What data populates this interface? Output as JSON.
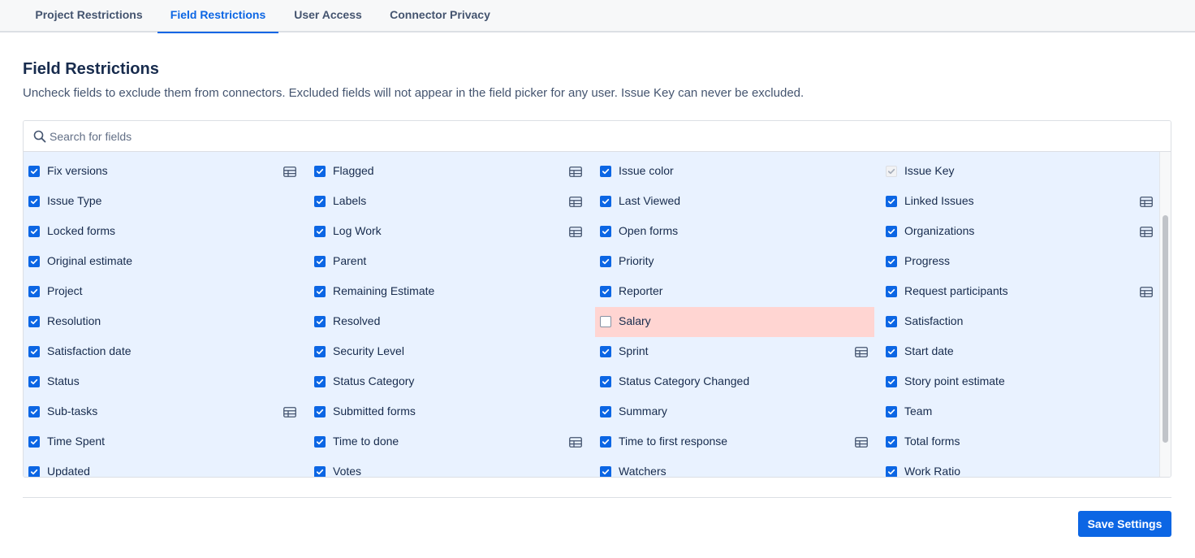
{
  "tabs": [
    {
      "label": "Project Restrictions",
      "active": false
    },
    {
      "label": "Field Restrictions",
      "active": true
    },
    {
      "label": "User Access",
      "active": false
    },
    {
      "label": "Connector Privacy",
      "active": false
    }
  ],
  "page": {
    "title": "Field Restrictions",
    "description": "Uncheck fields to exclude them from connectors. Excluded fields will not appear in the field picker for any user. Issue Key can never be excluded."
  },
  "search": {
    "placeholder": "Search for fields",
    "value": "",
    "icon": "search-icon"
  },
  "colors": {
    "accent": "#0c66e4",
    "row_bg": "#e9f2ff",
    "excluded_bg": "#ffd5d2"
  },
  "fields": [
    {
      "label": "Fix versions",
      "checked": true,
      "table_icon": true
    },
    {
      "label": "Flagged",
      "checked": true,
      "table_icon": true
    },
    {
      "label": "Issue color",
      "checked": true,
      "table_icon": false
    },
    {
      "label": "Issue Key",
      "checked": true,
      "disabled": true,
      "table_icon": false
    },
    {
      "label": "Issue Type",
      "checked": true,
      "table_icon": false
    },
    {
      "label": "Labels",
      "checked": true,
      "table_icon": true
    },
    {
      "label": "Last Viewed",
      "checked": true,
      "table_icon": false
    },
    {
      "label": "Linked Issues",
      "checked": true,
      "table_icon": true
    },
    {
      "label": "Locked forms",
      "checked": true,
      "table_icon": false
    },
    {
      "label": "Log Work",
      "checked": true,
      "table_icon": true
    },
    {
      "label": "Open forms",
      "checked": true,
      "table_icon": false
    },
    {
      "label": "Organizations",
      "checked": true,
      "table_icon": true
    },
    {
      "label": "Original estimate",
      "checked": true,
      "table_icon": false
    },
    {
      "label": "Parent",
      "checked": true,
      "table_icon": false
    },
    {
      "label": "Priority",
      "checked": true,
      "table_icon": false
    },
    {
      "label": "Progress",
      "checked": true,
      "table_icon": false
    },
    {
      "label": "Project",
      "checked": true,
      "table_icon": false
    },
    {
      "label": "Remaining Estimate",
      "checked": true,
      "table_icon": false
    },
    {
      "label": "Reporter",
      "checked": true,
      "table_icon": false
    },
    {
      "label": "Request participants",
      "checked": true,
      "table_icon": true
    },
    {
      "label": "Resolution",
      "checked": true,
      "table_icon": false
    },
    {
      "label": "Resolved",
      "checked": true,
      "table_icon": false
    },
    {
      "label": "Salary",
      "checked": false,
      "table_icon": false
    },
    {
      "label": "Satisfaction",
      "checked": true,
      "table_icon": false
    },
    {
      "label": "Satisfaction date",
      "checked": true,
      "table_icon": false
    },
    {
      "label": "Security Level",
      "checked": true,
      "table_icon": false
    },
    {
      "label": "Sprint",
      "checked": true,
      "table_icon": true
    },
    {
      "label": "Start date",
      "checked": true,
      "table_icon": false
    },
    {
      "label": "Status",
      "checked": true,
      "table_icon": false
    },
    {
      "label": "Status Category",
      "checked": true,
      "table_icon": false
    },
    {
      "label": "Status Category Changed",
      "checked": true,
      "table_icon": false
    },
    {
      "label": "Story point estimate",
      "checked": true,
      "table_icon": false
    },
    {
      "label": "Sub-tasks",
      "checked": true,
      "table_icon": true
    },
    {
      "label": "Submitted forms",
      "checked": true,
      "table_icon": false
    },
    {
      "label": "Summary",
      "checked": true,
      "table_icon": false
    },
    {
      "label": "Team",
      "checked": true,
      "table_icon": false
    },
    {
      "label": "Time Spent",
      "checked": true,
      "table_icon": false
    },
    {
      "label": "Time to done",
      "checked": true,
      "table_icon": true
    },
    {
      "label": "Time to first response",
      "checked": true,
      "table_icon": true
    },
    {
      "label": "Total forms",
      "checked": true,
      "table_icon": false
    },
    {
      "label": "Updated",
      "checked": true,
      "table_icon": false
    },
    {
      "label": "Votes",
      "checked": true,
      "table_icon": false
    },
    {
      "label": "Watchers",
      "checked": true,
      "table_icon": false
    },
    {
      "label": "Work Ratio",
      "checked": true,
      "table_icon": false
    }
  ],
  "footer": {
    "save_label": "Save Settings"
  }
}
